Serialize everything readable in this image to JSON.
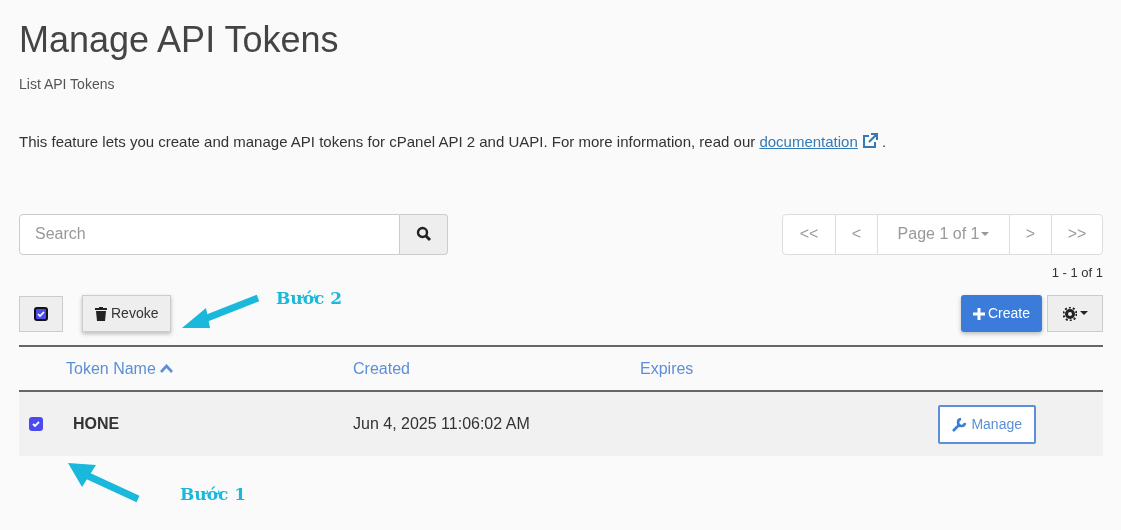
{
  "title": "Manage API Tokens",
  "subtitle": "List API Tokens",
  "intro": {
    "text": "This feature lets you create and manage API tokens for cPanel API 2 and UAPI. For more information, read our ",
    "link": "documentation",
    "end": "."
  },
  "search": {
    "placeholder": "Search"
  },
  "pagination": {
    "first": "<<",
    "prev": "<",
    "page": "Page 1 of 1",
    "next": ">",
    "last": ">>",
    "count": "1 - 1 of 1"
  },
  "toolbar": {
    "select_all_checked": true,
    "revoke": "Revoke",
    "create": "Create"
  },
  "table": {
    "columns": [
      {
        "label": "Token Name",
        "sorted": true
      },
      {
        "label": "Created",
        "sorted": false
      },
      {
        "label": "Expires",
        "sorted": false
      }
    ],
    "rows": [
      {
        "checked": true,
        "name": "HONE",
        "created": "Jun 4, 2025 11:06:02 AM",
        "action": "Manage"
      }
    ]
  },
  "annotations": [
    {
      "kind": "revoke",
      "label": "Bước 2"
    },
    {
      "kind": "row",
      "label": "Bước 1"
    }
  ]
}
